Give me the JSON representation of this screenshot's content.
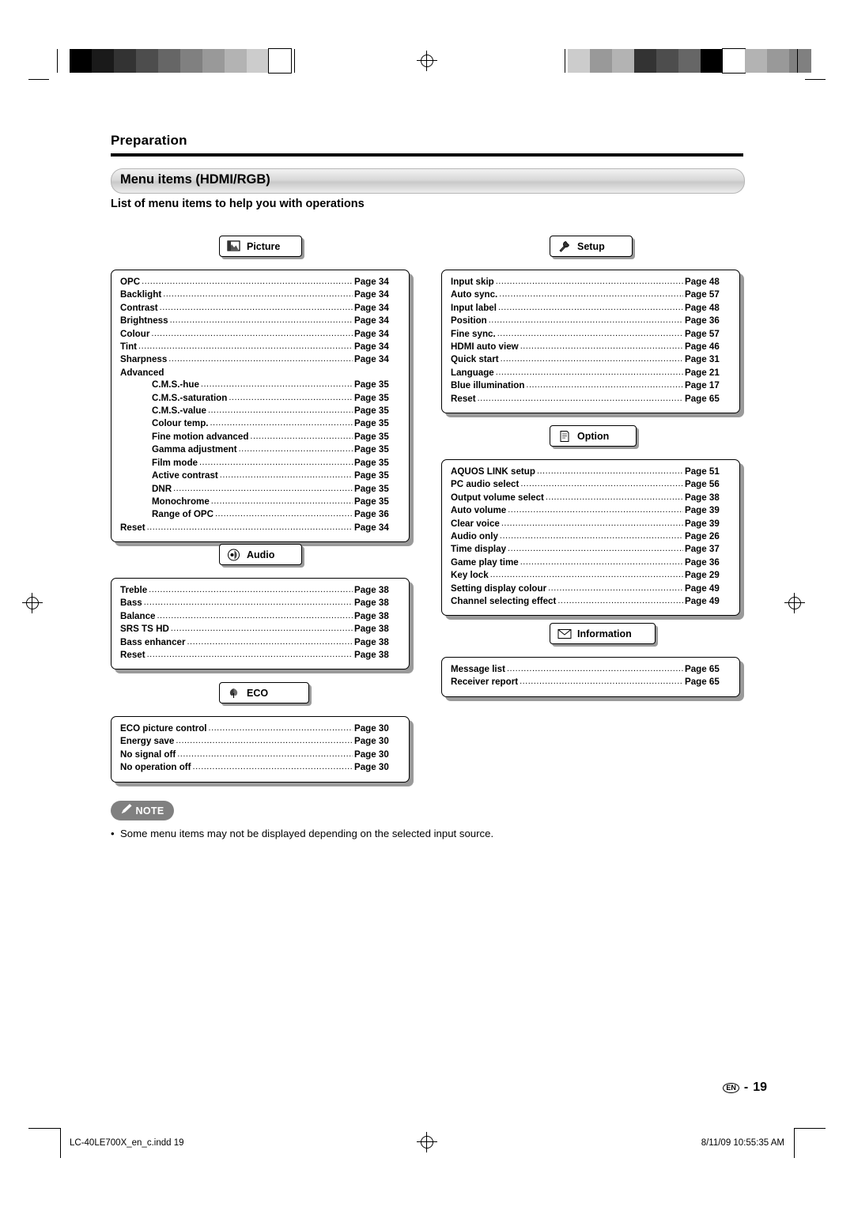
{
  "document": {
    "section_title": "Preparation",
    "banner_title": "Menu items (HDMI/RGB)",
    "subtitle": "List of menu items to help you with operations",
    "note_label": "NOTE",
    "note_text": "Some menu items may not be displayed depending on the selected input source.",
    "page_number": "19",
    "page_locale": "EN",
    "footer_left": "LC-40LE700X_en_c.indd   19",
    "footer_right": "8/11/09   10:55:35 AM"
  },
  "tabs": {
    "picture": {
      "label": "Picture",
      "icon": "picture-icon"
    },
    "audio": {
      "label": "Audio",
      "icon": "speaker-icon"
    },
    "eco": {
      "label": "ECO",
      "icon": "leaf-icon"
    },
    "setup": {
      "label": "Setup",
      "icon": "tools-icon"
    },
    "option": {
      "label": "Option",
      "icon": "note-icon"
    },
    "information": {
      "label": "Information",
      "icon": "envelope-icon"
    }
  },
  "lists": {
    "picture": [
      {
        "label": "OPC",
        "page": "Page 34",
        "indent": false
      },
      {
        "label": "Backlight",
        "page": "Page 34",
        "indent": false
      },
      {
        "label": "Contrast",
        "page": "Page 34",
        "indent": false
      },
      {
        "label": "Brightness",
        "page": "Page 34",
        "indent": false
      },
      {
        "label": "Colour",
        "page": "Page 34",
        "indent": false
      },
      {
        "label": "Tint",
        "page": "Page 34",
        "indent": false
      },
      {
        "label": "Sharpness",
        "page": "Page 34",
        "indent": false
      },
      {
        "label": "Advanced",
        "page": "",
        "indent": false
      },
      {
        "label": "C.M.S.-hue",
        "page": "Page 35",
        "indent": true
      },
      {
        "label": "C.M.S.-saturation",
        "page": "Page 35",
        "indent": true
      },
      {
        "label": "C.M.S.-value",
        "page": "Page 35",
        "indent": true
      },
      {
        "label": "Colour temp.",
        "page": "Page 35",
        "indent": true
      },
      {
        "label": "Fine motion advanced",
        "page": "Page 35",
        "indent": true
      },
      {
        "label": "Gamma adjustment",
        "page": "Page 35",
        "indent": true
      },
      {
        "label": "Film mode",
        "page": "Page 35",
        "indent": true
      },
      {
        "label": "Active contrast",
        "page": "Page 35",
        "indent": true
      },
      {
        "label": "DNR",
        "page": "Page 35",
        "indent": true
      },
      {
        "label": "Monochrome",
        "page": "Page 35",
        "indent": true
      },
      {
        "label": "Range of OPC",
        "page": "Page 36",
        "indent": true
      },
      {
        "label": "Reset",
        "page": "Page 34",
        "indent": false
      }
    ],
    "audio": [
      {
        "label": "Treble",
        "page": "Page 38",
        "indent": false
      },
      {
        "label": "Bass",
        "page": "Page 38",
        "indent": false
      },
      {
        "label": "Balance",
        "page": "Page 38",
        "indent": false
      },
      {
        "label": "SRS TS HD",
        "page": "Page 38",
        "indent": false
      },
      {
        "label": "Bass enhancer",
        "page": "Page 38",
        "indent": false
      },
      {
        "label": "Reset",
        "page": "Page 38",
        "indent": false
      }
    ],
    "eco": [
      {
        "label": "ECO picture control",
        "page": "Page 30",
        "indent": false
      },
      {
        "label": "Energy save",
        "page": "Page 30",
        "indent": false
      },
      {
        "label": "No signal off",
        "page": "Page 30",
        "indent": false
      },
      {
        "label": "No operation off",
        "page": "Page 30",
        "indent": false
      }
    ],
    "setup": [
      {
        "label": "Input skip",
        "page": "Page 48",
        "indent": false
      },
      {
        "label": "Auto sync.",
        "page": "Page 57",
        "indent": false
      },
      {
        "label": "Input label",
        "page": "Page 48",
        "indent": false
      },
      {
        "label": "Position",
        "page": "Page 36",
        "indent": false
      },
      {
        "label": "Fine sync.",
        "page": "Page 57",
        "indent": false
      },
      {
        "label": "HDMI auto view",
        "page": "Page 46",
        "indent": false
      },
      {
        "label": "Quick start",
        "page": "Page 31",
        "indent": false
      },
      {
        "label": "Language",
        "page": "Page 21",
        "indent": false
      },
      {
        "label": "Blue illumination",
        "page": "Page 17",
        "indent": false
      },
      {
        "label": "Reset",
        "page": "Page 65",
        "indent": false
      }
    ],
    "option": [
      {
        "label": "AQUOS LINK setup",
        "page": "Page 51",
        "indent": false
      },
      {
        "label": "PC audio select",
        "page": "Page 56",
        "indent": false
      },
      {
        "label": "Output volume select",
        "page": "Page 38",
        "indent": false
      },
      {
        "label": "Auto volume",
        "page": "Page 39",
        "indent": false
      },
      {
        "label": "Clear voice",
        "page": "Page 39",
        "indent": false
      },
      {
        "label": "Audio only",
        "page": "Page 26",
        "indent": false
      },
      {
        "label": "Time display",
        "page": "Page 37",
        "indent": false
      },
      {
        "label": "Game play time",
        "page": "Page 36",
        "indent": false
      },
      {
        "label": "Key lock",
        "page": "Page 29",
        "indent": false
      },
      {
        "label": "Setting display colour",
        "page": "Page 49",
        "indent": false
      },
      {
        "label": "Channel selecting effect",
        "page": "Page 49",
        "indent": false
      }
    ],
    "information": [
      {
        "label": "Message list",
        "page": "Page 65",
        "indent": false
      },
      {
        "label": "Receiver report",
        "page": "Page 65",
        "indent": false
      }
    ]
  },
  "print_marks": {
    "left_bar_swatches": [
      "#000000",
      "#1a1a1a",
      "#333333",
      "#4d4d4d",
      "#666666",
      "#808080",
      "#999999",
      "#b3b3b3",
      "#cccccc",
      "#ffffff"
    ],
    "right_bar_swatches": [
      "#cccccc",
      "#999999",
      "#b3b3b3",
      "#333333",
      "#4d4d4d",
      "#666666",
      "#000000",
      "#ffffff",
      "#b3b3b3",
      "#999999",
      "#808080"
    ]
  }
}
